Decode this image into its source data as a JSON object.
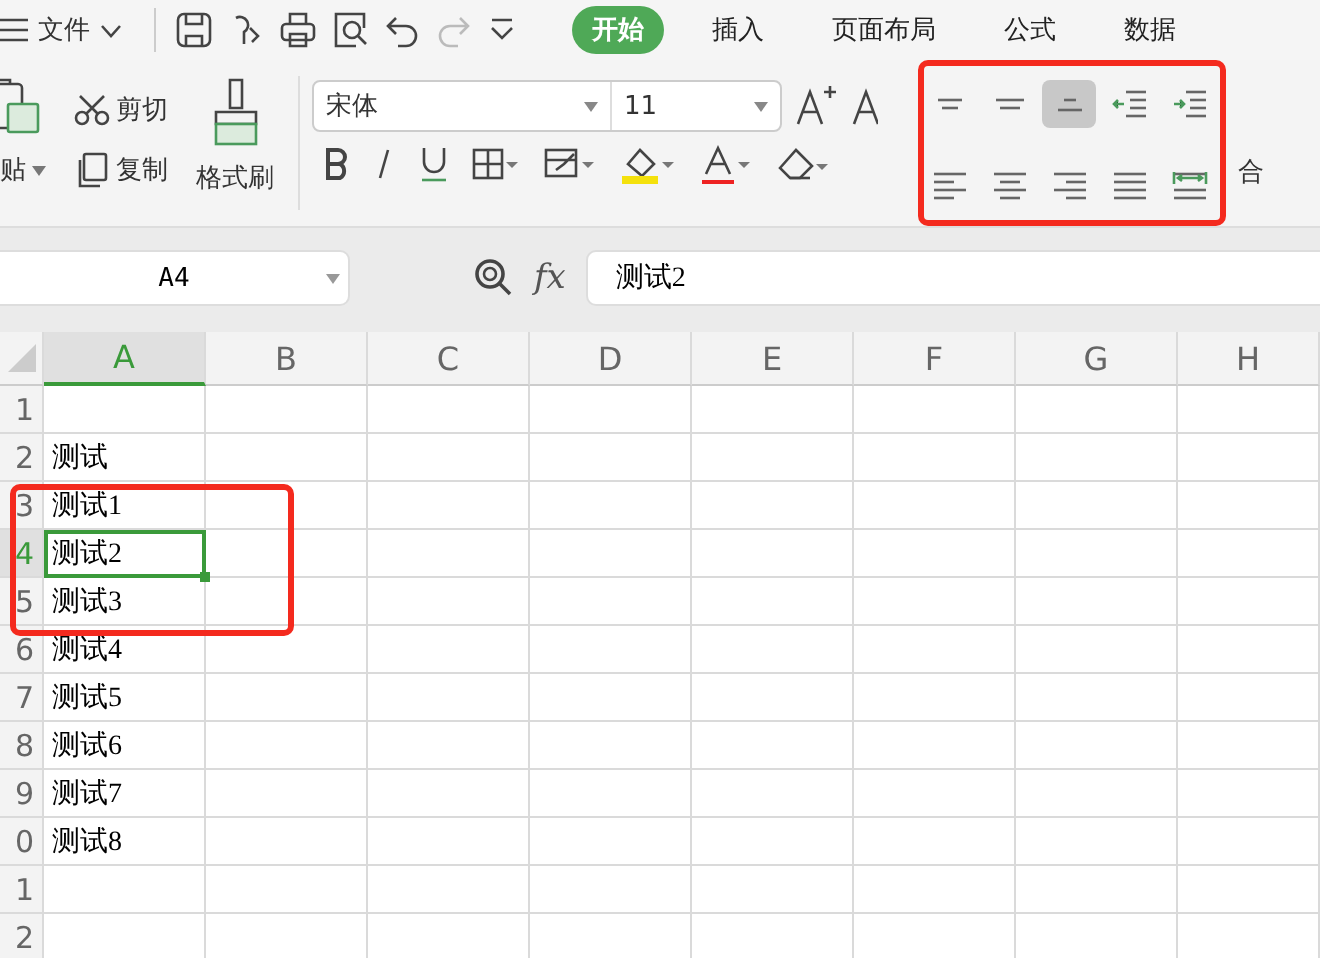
{
  "menu_bar": {
    "menu": "文件",
    "tabs": [
      {
        "label": "开始",
        "selected": true
      },
      {
        "label": "插入",
        "selected": false
      },
      {
        "label": "页面布局",
        "selected": false
      },
      {
        "label": "公式",
        "selected": false
      },
      {
        "label": "数据",
        "selected": false
      }
    ]
  },
  "ribbon": {
    "clipboard": {
      "paste": "贴",
      "cut": "剪切",
      "copy": "复制",
      "format_painter": "格式刷"
    },
    "font": {
      "name": "宋体",
      "size": "11"
    },
    "alignment": [
      {
        "kind": "top",
        "selected": false
      },
      {
        "kind": "middle",
        "selected": false
      },
      {
        "kind": "bottom",
        "selected": true
      },
      {
        "kind": "outdent",
        "selected": false
      },
      {
        "kind": "indent",
        "selected": false
      },
      {
        "kind": "left",
        "selected": false
      },
      {
        "kind": "center",
        "selected": false
      },
      {
        "kind": "right",
        "selected": false
      },
      {
        "kind": "justify",
        "selected": false
      },
      {
        "kind": "distributed",
        "selected": false
      }
    ],
    "merge": "合"
  },
  "formula_bar": {
    "name_box": "A4",
    "function_label": "fx",
    "formula": "测试2"
  },
  "sheet": {
    "columns": [
      {
        "label": "A",
        "selected": true
      },
      {
        "label": "B",
        "selected": false
      },
      {
        "label": "C",
        "selected": false
      },
      {
        "label": "D",
        "selected": false
      },
      {
        "label": "E",
        "selected": false
      },
      {
        "label": "F",
        "selected": false
      },
      {
        "label": "G",
        "selected": false
      },
      {
        "label": "H",
        "selected": false
      }
    ],
    "rows": [
      {
        "label": "1",
        "selected": false
      },
      {
        "label": "2",
        "selected": false,
        "a": "测试"
      },
      {
        "label": "3",
        "selected": false,
        "a": "测试1"
      },
      {
        "label": "4",
        "selected": true,
        "a": "测试2"
      },
      {
        "label": "5",
        "selected": false,
        "a": "测试3"
      },
      {
        "label": "6",
        "selected": false,
        "a": "测试4"
      },
      {
        "label": "7",
        "selected": false,
        "a": "测试5"
      },
      {
        "label": "8",
        "selected": false,
        "a": "测试6"
      },
      {
        "label": "9",
        "selected": false,
        "a": "测试7"
      },
      {
        "label": "0",
        "selected": false,
        "a": "测试8"
      },
      {
        "label": "1",
        "selected": false
      },
      {
        "label": "2",
        "selected": false
      }
    ]
  }
}
